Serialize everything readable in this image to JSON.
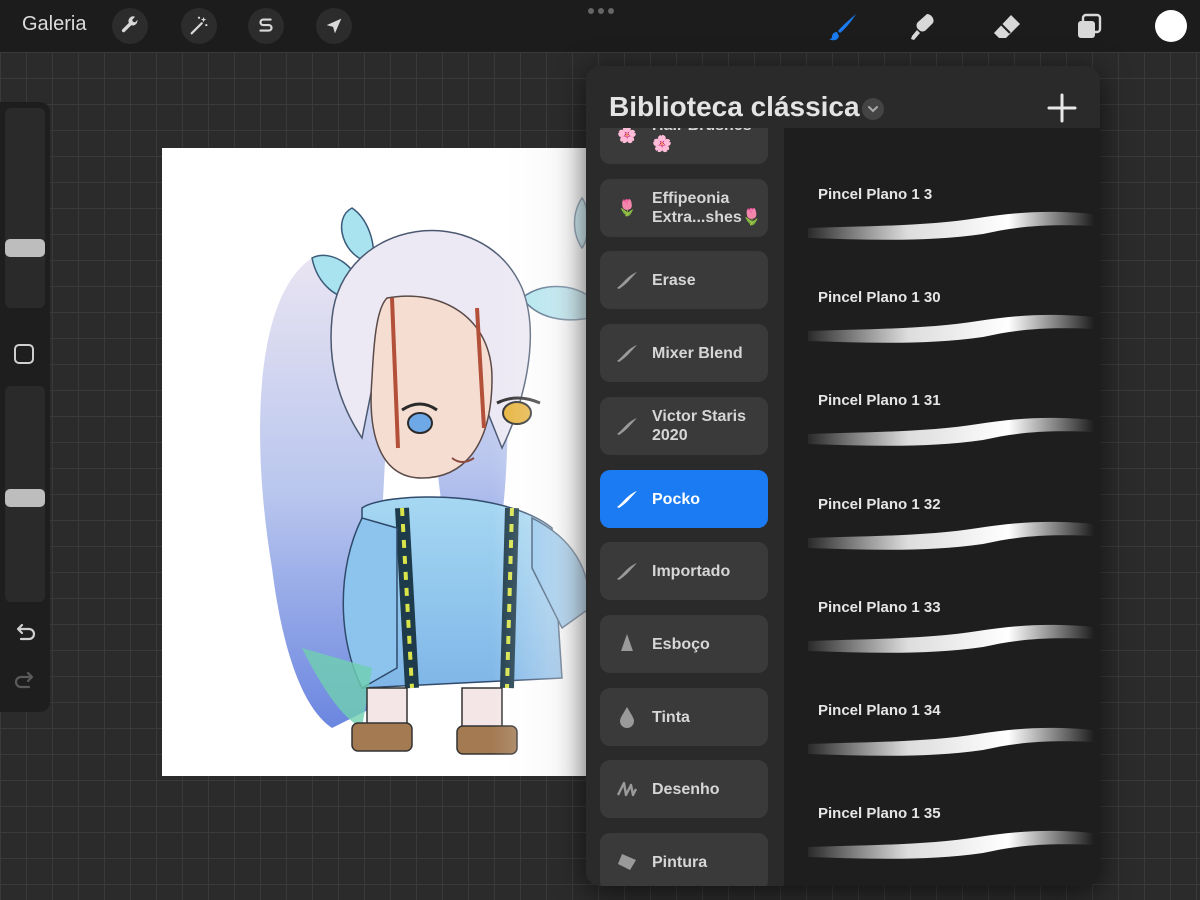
{
  "topbar": {
    "gallery_label": "Galeria",
    "tools": [
      "wrench-icon",
      "magic-wand-icon",
      "selection-s-icon",
      "transform-arrow-icon"
    ],
    "right_tools": [
      "brush-icon",
      "smudge-icon",
      "eraser-icon",
      "layers-icon"
    ],
    "active_tool": "brush",
    "active_color": "#1a7bf2",
    "current_color": "#ffffff"
  },
  "sidebar": {
    "brush_size_level": 0.28,
    "opacity_level": 0.48,
    "undo_icon": "undo-icon",
    "redo_icon": "redo-icon"
  },
  "panel": {
    "title": "Biblioteca clássica",
    "add_icon": "plus-icon",
    "brush_sets": [
      {
        "label": "Hair Brushes\n🌸",
        "icon": "🌸",
        "active": false
      },
      {
        "label": "Effipeonia\nExtra...shes🌷",
        "icon": "🌷",
        "active": false
      },
      {
        "label": "Erase",
        "icon": "stroke-icon",
        "active": false
      },
      {
        "label": "Mixer Blend",
        "icon": "stroke-icon",
        "active": false
      },
      {
        "label": "Victor Staris\n2020",
        "icon": "stroke-icon",
        "active": false
      },
      {
        "label": "Pocko",
        "icon": "stroke-icon",
        "active": true
      },
      {
        "label": "Importado",
        "icon": "stroke-icon",
        "active": false
      },
      {
        "label": "Esboço",
        "icon": "pencil-tip-icon",
        "active": false
      },
      {
        "label": "Tinta",
        "icon": "ink-drop-icon",
        "active": false
      },
      {
        "label": "Desenho",
        "icon": "scribble-icon",
        "active": false
      },
      {
        "label": "Pintura",
        "icon": "paint-brush-icon",
        "active": false
      }
    ],
    "brushes": [
      {
        "name": "Pincel Plano 1 3"
      },
      {
        "name": "Pincel Plano 1 30"
      },
      {
        "name": "Pincel Plano 1 31"
      },
      {
        "name": "Pincel Plano 1 32"
      },
      {
        "name": "Pincel Plano 1 33"
      },
      {
        "name": "Pincel Plano 1 34"
      },
      {
        "name": "Pincel Plano 1 35"
      }
    ]
  }
}
